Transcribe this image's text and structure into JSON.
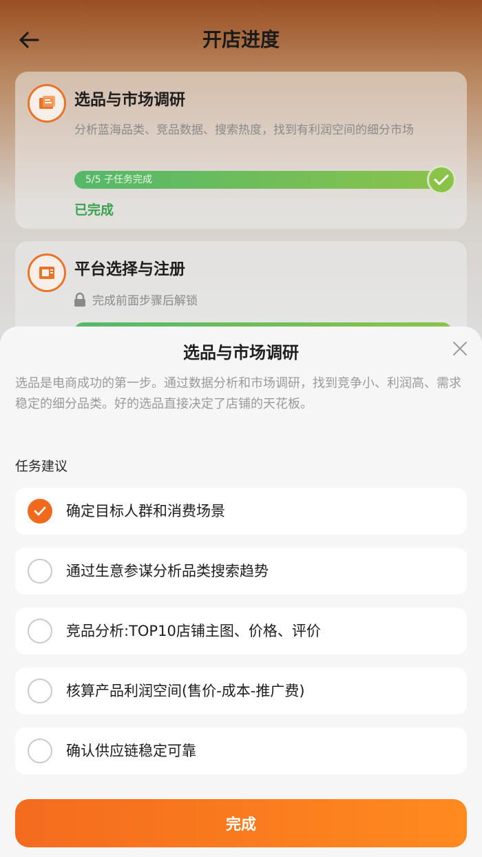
{
  "header": {
    "title": "开店进度",
    "back_icon": "arrow-left-icon"
  },
  "steps": [
    {
      "title": "选品与市场调研",
      "icon": "research-icon",
      "description": "分析蓝海品类、竞品数据、搜索热度，找到有利润空间的细分市场",
      "progress_text": "5/5 子任务完成",
      "progress": 1.0,
      "status": "已完成"
    },
    {
      "title": "平台选择与注册",
      "icon": "register-icon",
      "locked_text": "完成前面步骤后解锁"
    }
  ],
  "sheet": {
    "title": "选品与市场调研",
    "description": "选品是电商成功的第一步。通过数据分析和市场调研，找到竞争小、利润高、需求稳定的细分品类。好的选品直接决定了店铺的天花板。",
    "section_label": "任务建议",
    "tasks": [
      {
        "label": "确定目标人群和消费场景",
        "checked": true
      },
      {
        "label": "通过生意参谋分析品类搜索趋势",
        "checked": false
      },
      {
        "label": "竞品分析:TOP10店铺主图、价格、评价",
        "checked": false
      },
      {
        "label": "核算产品利润空间(售价-成本-推广费)",
        "checked": false
      },
      {
        "label": "确认供应链稳定可靠",
        "checked": false
      }
    ],
    "done_label": "完成"
  },
  "colors": {
    "accent": "#f06a1e",
    "success": "#3aa24f",
    "progress_start": "#54b86a",
    "progress_end": "#8bc34a"
  }
}
